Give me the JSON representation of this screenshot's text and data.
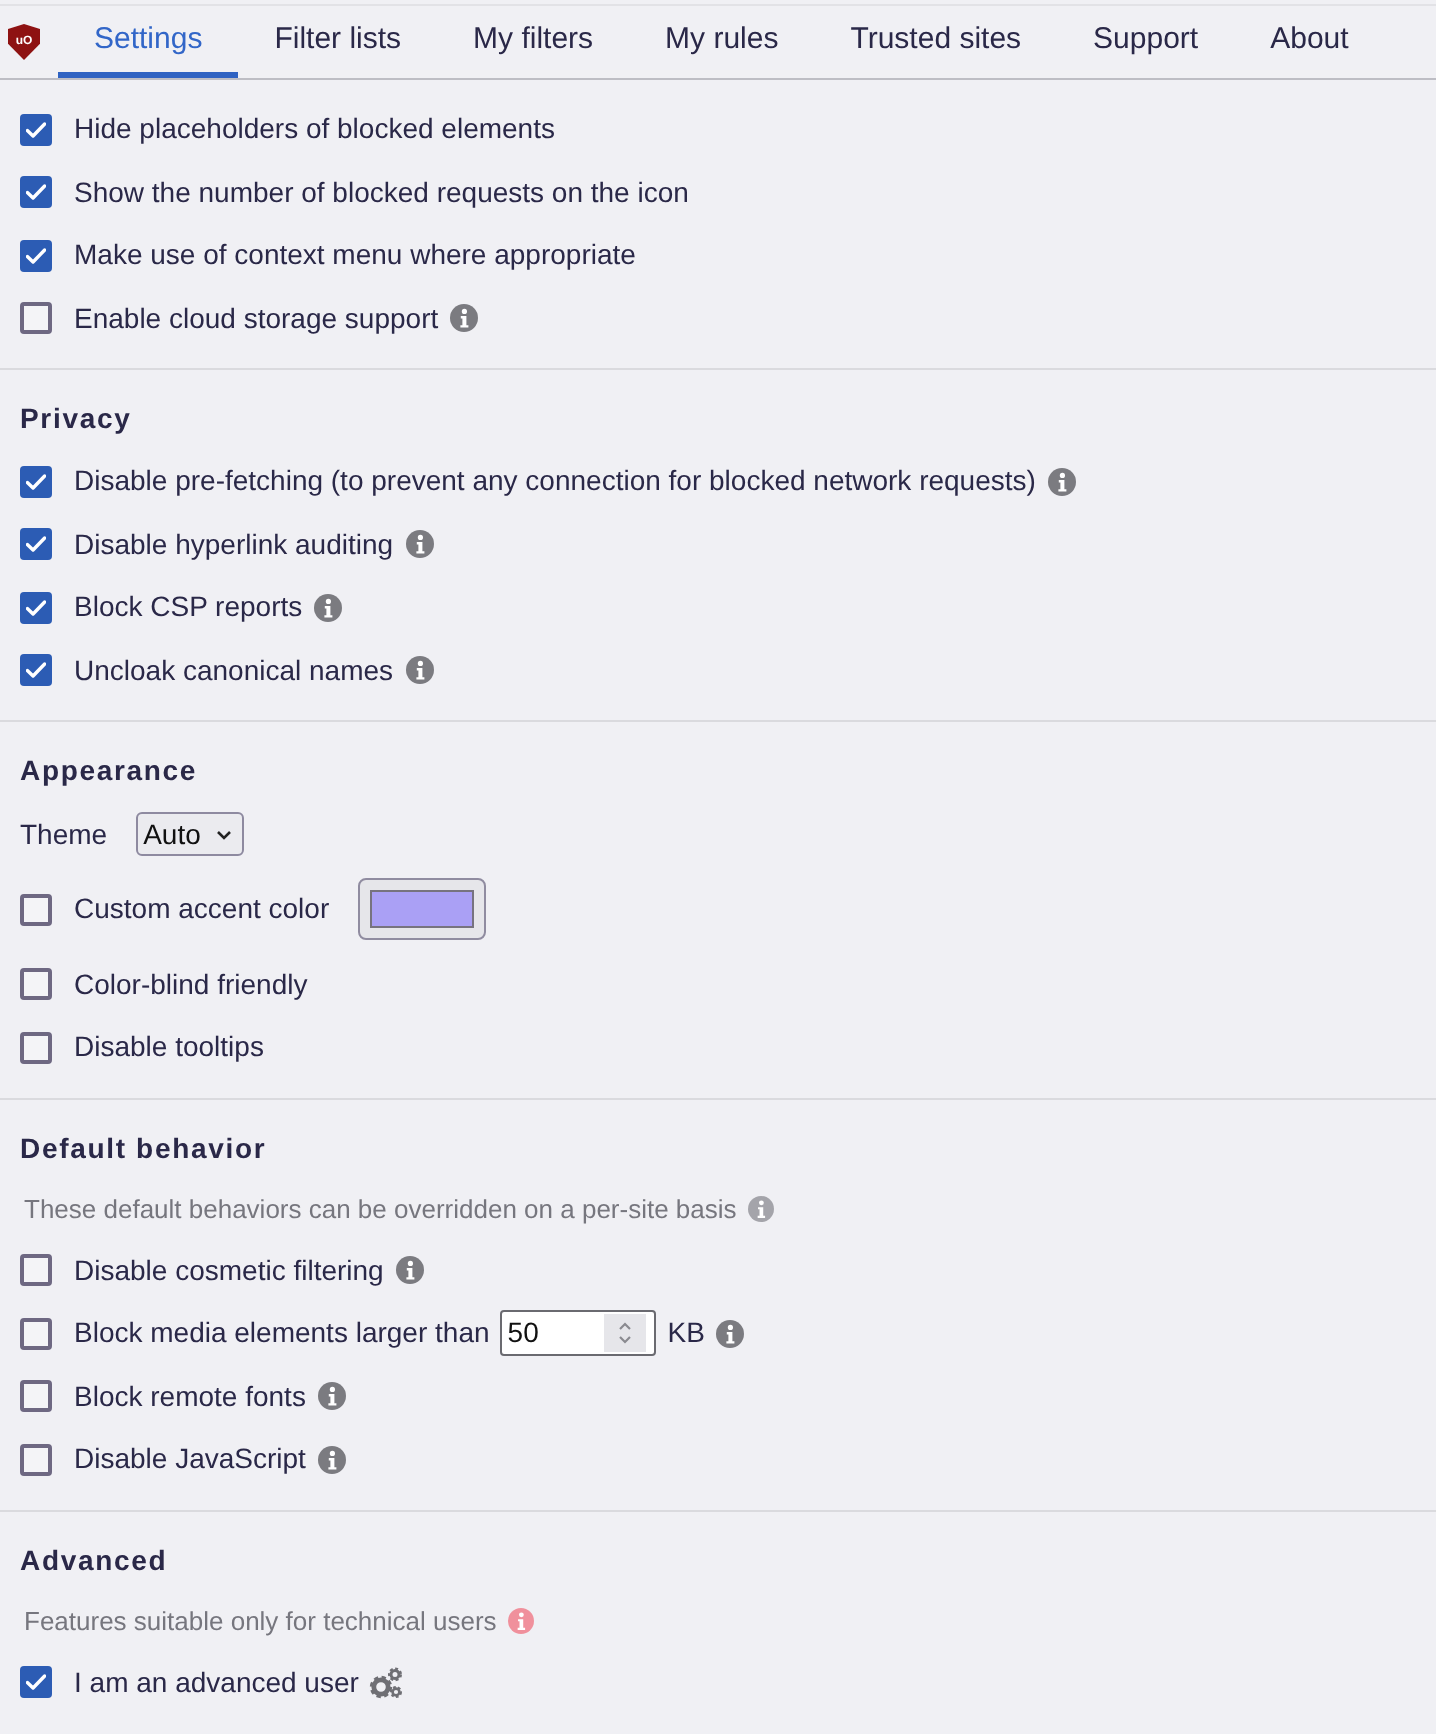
{
  "logo": {
    "text": "uO"
  },
  "tabs": [
    {
      "label": "Settings",
      "selected": true
    },
    {
      "label": "Filter lists",
      "selected": false
    },
    {
      "label": "My filters",
      "selected": false
    },
    {
      "label": "My rules",
      "selected": false
    },
    {
      "label": "Trusted sites",
      "selected": false
    },
    {
      "label": "Support",
      "selected": false
    },
    {
      "label": "About",
      "selected": false
    }
  ],
  "sections": [
    {
      "items": [
        {
          "kind": "checkbox",
          "label": "Hide placeholders of blocked elements",
          "checked": true,
          "info": false
        },
        {
          "kind": "checkbox",
          "label": "Show the number of blocked requests on the icon",
          "checked": true,
          "info": false
        },
        {
          "kind": "checkbox",
          "label": "Make use of context menu where appropriate",
          "checked": true,
          "info": false
        },
        {
          "kind": "checkbox",
          "label": "Enable cloud storage support",
          "checked": false,
          "info": true
        }
      ]
    },
    {
      "heading": "Privacy",
      "items": [
        {
          "kind": "checkbox",
          "label": "Disable pre-fetching (to prevent any connection for blocked network requests)",
          "checked": true,
          "info": true
        },
        {
          "kind": "checkbox",
          "label": "Disable hyperlink auditing",
          "checked": true,
          "info": true
        },
        {
          "kind": "checkbox",
          "label": "Block CSP reports",
          "checked": true,
          "info": true
        },
        {
          "kind": "checkbox",
          "label": "Uncloak canonical names",
          "checked": true,
          "info": true
        }
      ]
    },
    {
      "heading": "Appearance",
      "items": [
        {
          "kind": "select",
          "label": "Theme",
          "value": "Auto"
        },
        {
          "kind": "color",
          "label": "Custom accent color",
          "checked": false,
          "color": "#aaa0f5"
        },
        {
          "kind": "checkbox",
          "label": "Color-blind friendly",
          "checked": false,
          "info": false
        },
        {
          "kind": "checkbox",
          "label": "Disable tooltips",
          "checked": false,
          "info": false
        }
      ]
    },
    {
      "heading": "Default behavior",
      "note": {
        "text": "These default behaviors can be overridden on a per-site basis",
        "alert": false
      },
      "items": [
        {
          "kind": "checkbox",
          "label": "Disable cosmetic filtering",
          "checked": false,
          "info": true
        },
        {
          "kind": "number",
          "label": "Block media elements larger than",
          "checked": false,
          "value": "50",
          "unit": "KB",
          "info": true
        },
        {
          "kind": "checkbox",
          "label": "Block remote fonts",
          "checked": false,
          "info": true
        },
        {
          "kind": "checkbox",
          "label": "Disable JavaScript",
          "checked": false,
          "info": true
        }
      ]
    },
    {
      "heading": "Advanced",
      "note": {
        "text": "Features suitable only for technical users",
        "alert": true
      },
      "items": [
        {
          "kind": "settings",
          "label": "I am an advanced user",
          "checked": true
        }
      ]
    }
  ]
}
